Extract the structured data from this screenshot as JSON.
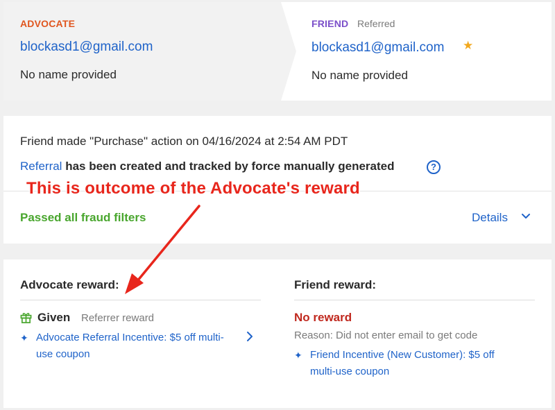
{
  "advocate": {
    "role_label": "ADVOCATE",
    "email": "blockasd1@gmail.com",
    "name": "No name provided"
  },
  "friend": {
    "role_label": "FRIEND",
    "role_sub": "Referred",
    "email": "blockasd1@gmail.com",
    "name": "No name provided",
    "badge_icon": "star-icon"
  },
  "activity": {
    "action_text": "Friend made \"Purchase\" action on 04/16/2024 at 2:54 AM PDT",
    "referral_link": "Referral",
    "tracked_text": " has been created and tracked by force manually generated",
    "help_glyph": "?",
    "fraud_status": "Passed all fraud filters",
    "details_label": "Details"
  },
  "rewards": {
    "advocate": {
      "title": "Advocate reward:",
      "status": "Given",
      "status_sub": "Referrer reward",
      "incentive": "Advocate Referral Incentive: $5 off multi-use coupon"
    },
    "friend": {
      "title": "Friend reward:",
      "status": "No reward",
      "reason": "Reason: Did not enter email to get code",
      "incentive": "Friend Incentive (New Customer): $5 off multi-use coupon"
    }
  },
  "annotation": {
    "text": "This is outcome of the Advocate's reward",
    "color": "#e8261c"
  },
  "colors": {
    "advocate_accent": "#e0561f",
    "friend_accent": "#7b4fc9",
    "link": "#1f63c9",
    "success": "#49a62e",
    "error": "#c0281e",
    "star": "#f2a81d"
  }
}
